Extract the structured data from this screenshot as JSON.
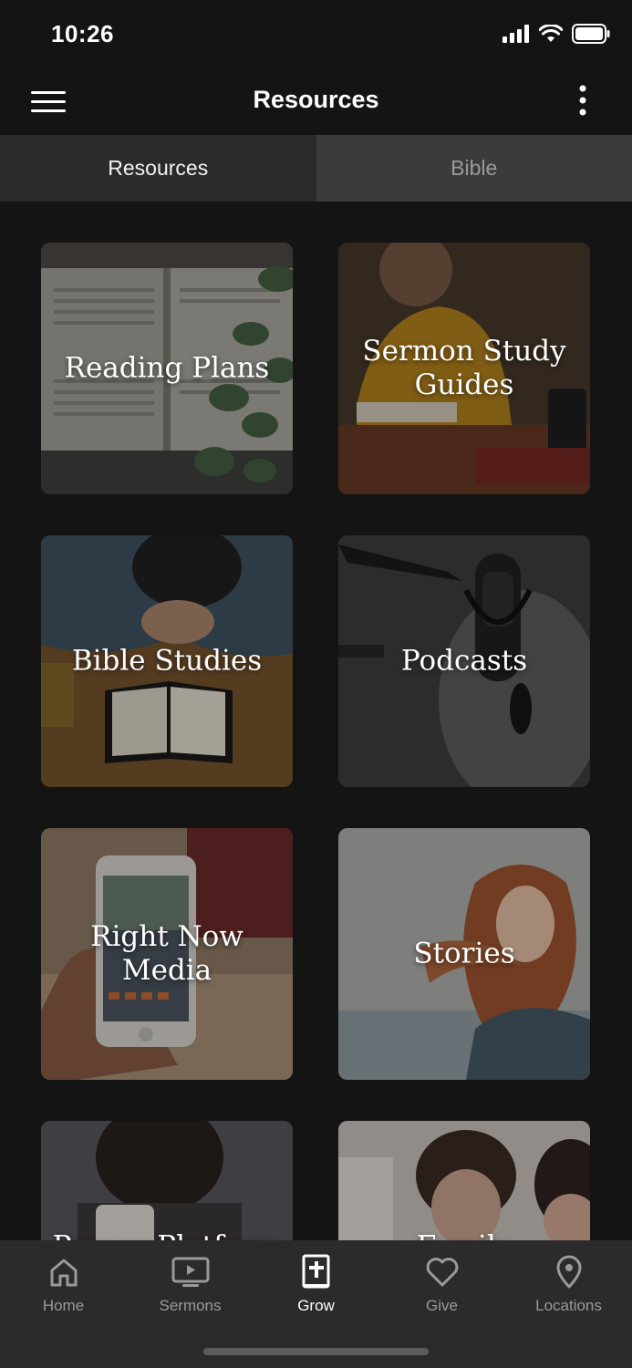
{
  "status": {
    "time": "10:26"
  },
  "header": {
    "title": "Resources"
  },
  "segments": [
    {
      "label": "Resources",
      "active": true
    },
    {
      "label": "Bible",
      "active": false
    }
  ],
  "cards": [
    {
      "label": "Reading Plans",
      "image": "open-bible-with-eucalyptus"
    },
    {
      "label": "Sermon Study Guides",
      "image": "woman-reading-in-cafe"
    },
    {
      "label": "Bible Studies",
      "image": "man-praying-over-bible"
    },
    {
      "label": "Podcasts",
      "image": "studio-microphone"
    },
    {
      "label": "Right Now Media",
      "image": "phone-showing-judges-video"
    },
    {
      "label": "Stories",
      "image": "woman-with-windblown-hair"
    },
    {
      "label": "Prayer Platform",
      "image": "woman-with-coffee-mug"
    },
    {
      "label": "Family",
      "image": "mother-and-daughter-reading"
    }
  ],
  "tabbar": [
    {
      "label": "Home",
      "icon": "home-icon",
      "active": false
    },
    {
      "label": "Sermons",
      "icon": "tv-play-icon",
      "active": false
    },
    {
      "label": "Grow",
      "icon": "bible-cross-icon",
      "active": true
    },
    {
      "label": "Give",
      "icon": "heart-icon",
      "active": false
    },
    {
      "label": "Locations",
      "icon": "map-pin-icon",
      "active": false
    }
  ],
  "colors": {
    "background": "#141414",
    "tab_active_bg": "#2b2b2b",
    "tab_inactive_bg": "#3b3b3b",
    "tabbar_bg": "#2b2b2b",
    "inactive_text": "#9a9a9a"
  }
}
